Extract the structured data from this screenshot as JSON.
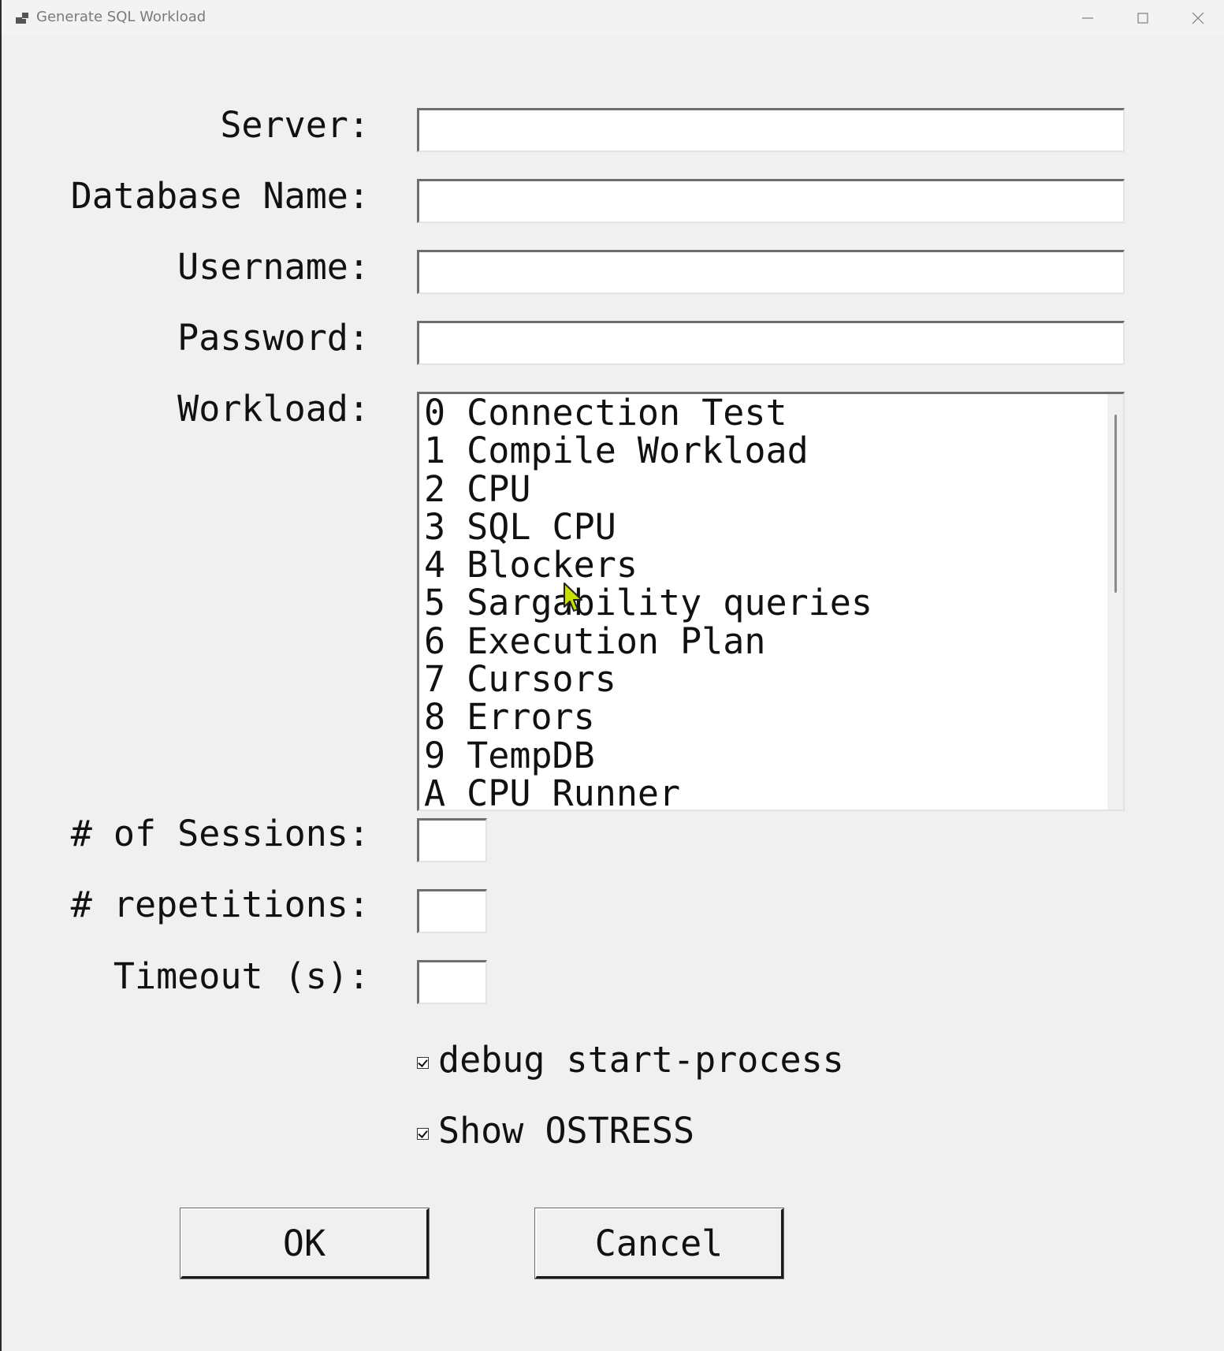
{
  "window": {
    "title": "Generate SQL Workload",
    "controls": {
      "minimize_icon": "minimize-icon",
      "maximize_icon": "maximize-icon",
      "close_icon": "close-icon"
    }
  },
  "form": {
    "server_label": "Server:",
    "database_label": "Database Name:",
    "username_label": "Username:",
    "password_label": "Password:",
    "workload_label": "Workload:",
    "sessions_label": "# of Sessions:",
    "repetitions_label": "# repetitions:",
    "timeout_label": "Timeout (s):",
    "server_value": "",
    "database_value": "",
    "username_value": "",
    "password_value": "",
    "sessions_value": "",
    "repetitions_value": "",
    "timeout_value": ""
  },
  "workloads": [
    "0 Connection Test",
    "1 Compile Workload",
    "2 CPU",
    "3 SQL CPU",
    "4 Blockers",
    "5 Sargability queries",
    "6 Execution Plan",
    "7 Cursors",
    "8 Errors",
    "9 TempDB",
    "A CPU Runner"
  ],
  "options": {
    "debug_label": "debug start-process",
    "debug_checked": true,
    "ostress_label": "Show OSTRESS",
    "ostress_checked": true
  },
  "buttons": {
    "ok": "OK",
    "cancel": "Cancel"
  },
  "colors": {
    "window_bg": "#f0f0f0",
    "cursor_fill": "#c8e000"
  }
}
